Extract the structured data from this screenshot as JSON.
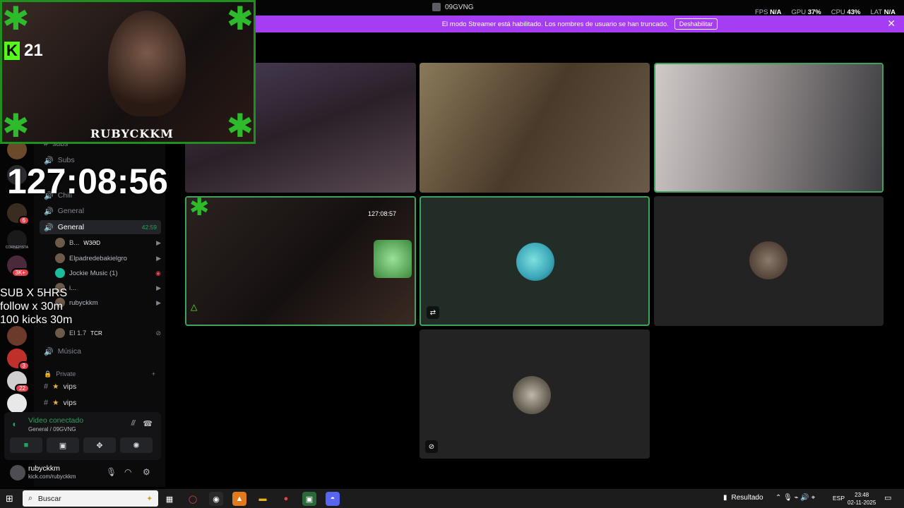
{
  "window": {
    "title": "09GVNG",
    "stats": [
      {
        "label": "FPS",
        "value": "N/A"
      },
      {
        "label": "GPU",
        "value": "37%"
      },
      {
        "label": "CPU",
        "value": "43%"
      },
      {
        "label": "LAT",
        "value": "N/A"
      }
    ]
  },
  "banner": {
    "text": "El modo Streamer está habilitado. Los nombres de usuario se han truncado.",
    "button": "Deshabilitar",
    "close": "✕"
  },
  "overlay": {
    "kick_count": "21",
    "brand": "RUBYCKKM",
    "timer": "127:08:56",
    "goals": [
      "SUB X 5HRS",
      "follow x 30m",
      "100 kicks 30m"
    ]
  },
  "server_rail": {
    "badges": [
      "6",
      "3K+",
      "3",
      "22"
    ],
    "labels": [
      "CORNEPISTA"
    ]
  },
  "sidebar": {
    "channels": [
      {
        "name": "subs",
        "icon": "#"
      },
      {
        "name": "Subs",
        "icon": "🔊"
      },
      {
        "name": "Chill",
        "icon": "🔊"
      },
      {
        "name": "General",
        "icon": "🔊"
      },
      {
        "name": "General",
        "icon": "🔊",
        "time": "42:59"
      },
      {
        "name": "Música",
        "icon": "🔊"
      }
    ],
    "voice_users": [
      {
        "name": "B...",
        "tag": "W3ƏD"
      },
      {
        "name": "Elpadredebakielgro"
      },
      {
        "name": "Jockie Music (1)"
      },
      {
        "name": "i..."
      },
      {
        "name": "rubyckkm"
      },
      {
        "name": "El 1.7",
        "tag": "TCR"
      }
    ],
    "category": "Private",
    "private_channels": [
      {
        "name": "vips",
        "icon": "#"
      },
      {
        "name": "vips",
        "icon": "#"
      }
    ]
  },
  "voice_panel": {
    "status": "Video conectado",
    "subtitle": "General / 09GVNG"
  },
  "user_bar": {
    "name": "rubyckkm",
    "status": "kick.com/rubyckkm"
  },
  "stream_tile": {
    "timer": "127:08:57"
  },
  "taskbar": {
    "search_placeholder": "Buscar",
    "result_label": "Resultado",
    "language": "ESP",
    "time": "23:48",
    "date": "02-11-2025"
  },
  "colors": {
    "banner": "#a53df2",
    "speaking_border": "#3ba55c",
    "kick_green": "#53fc18",
    "connected_green": "#23a559"
  }
}
